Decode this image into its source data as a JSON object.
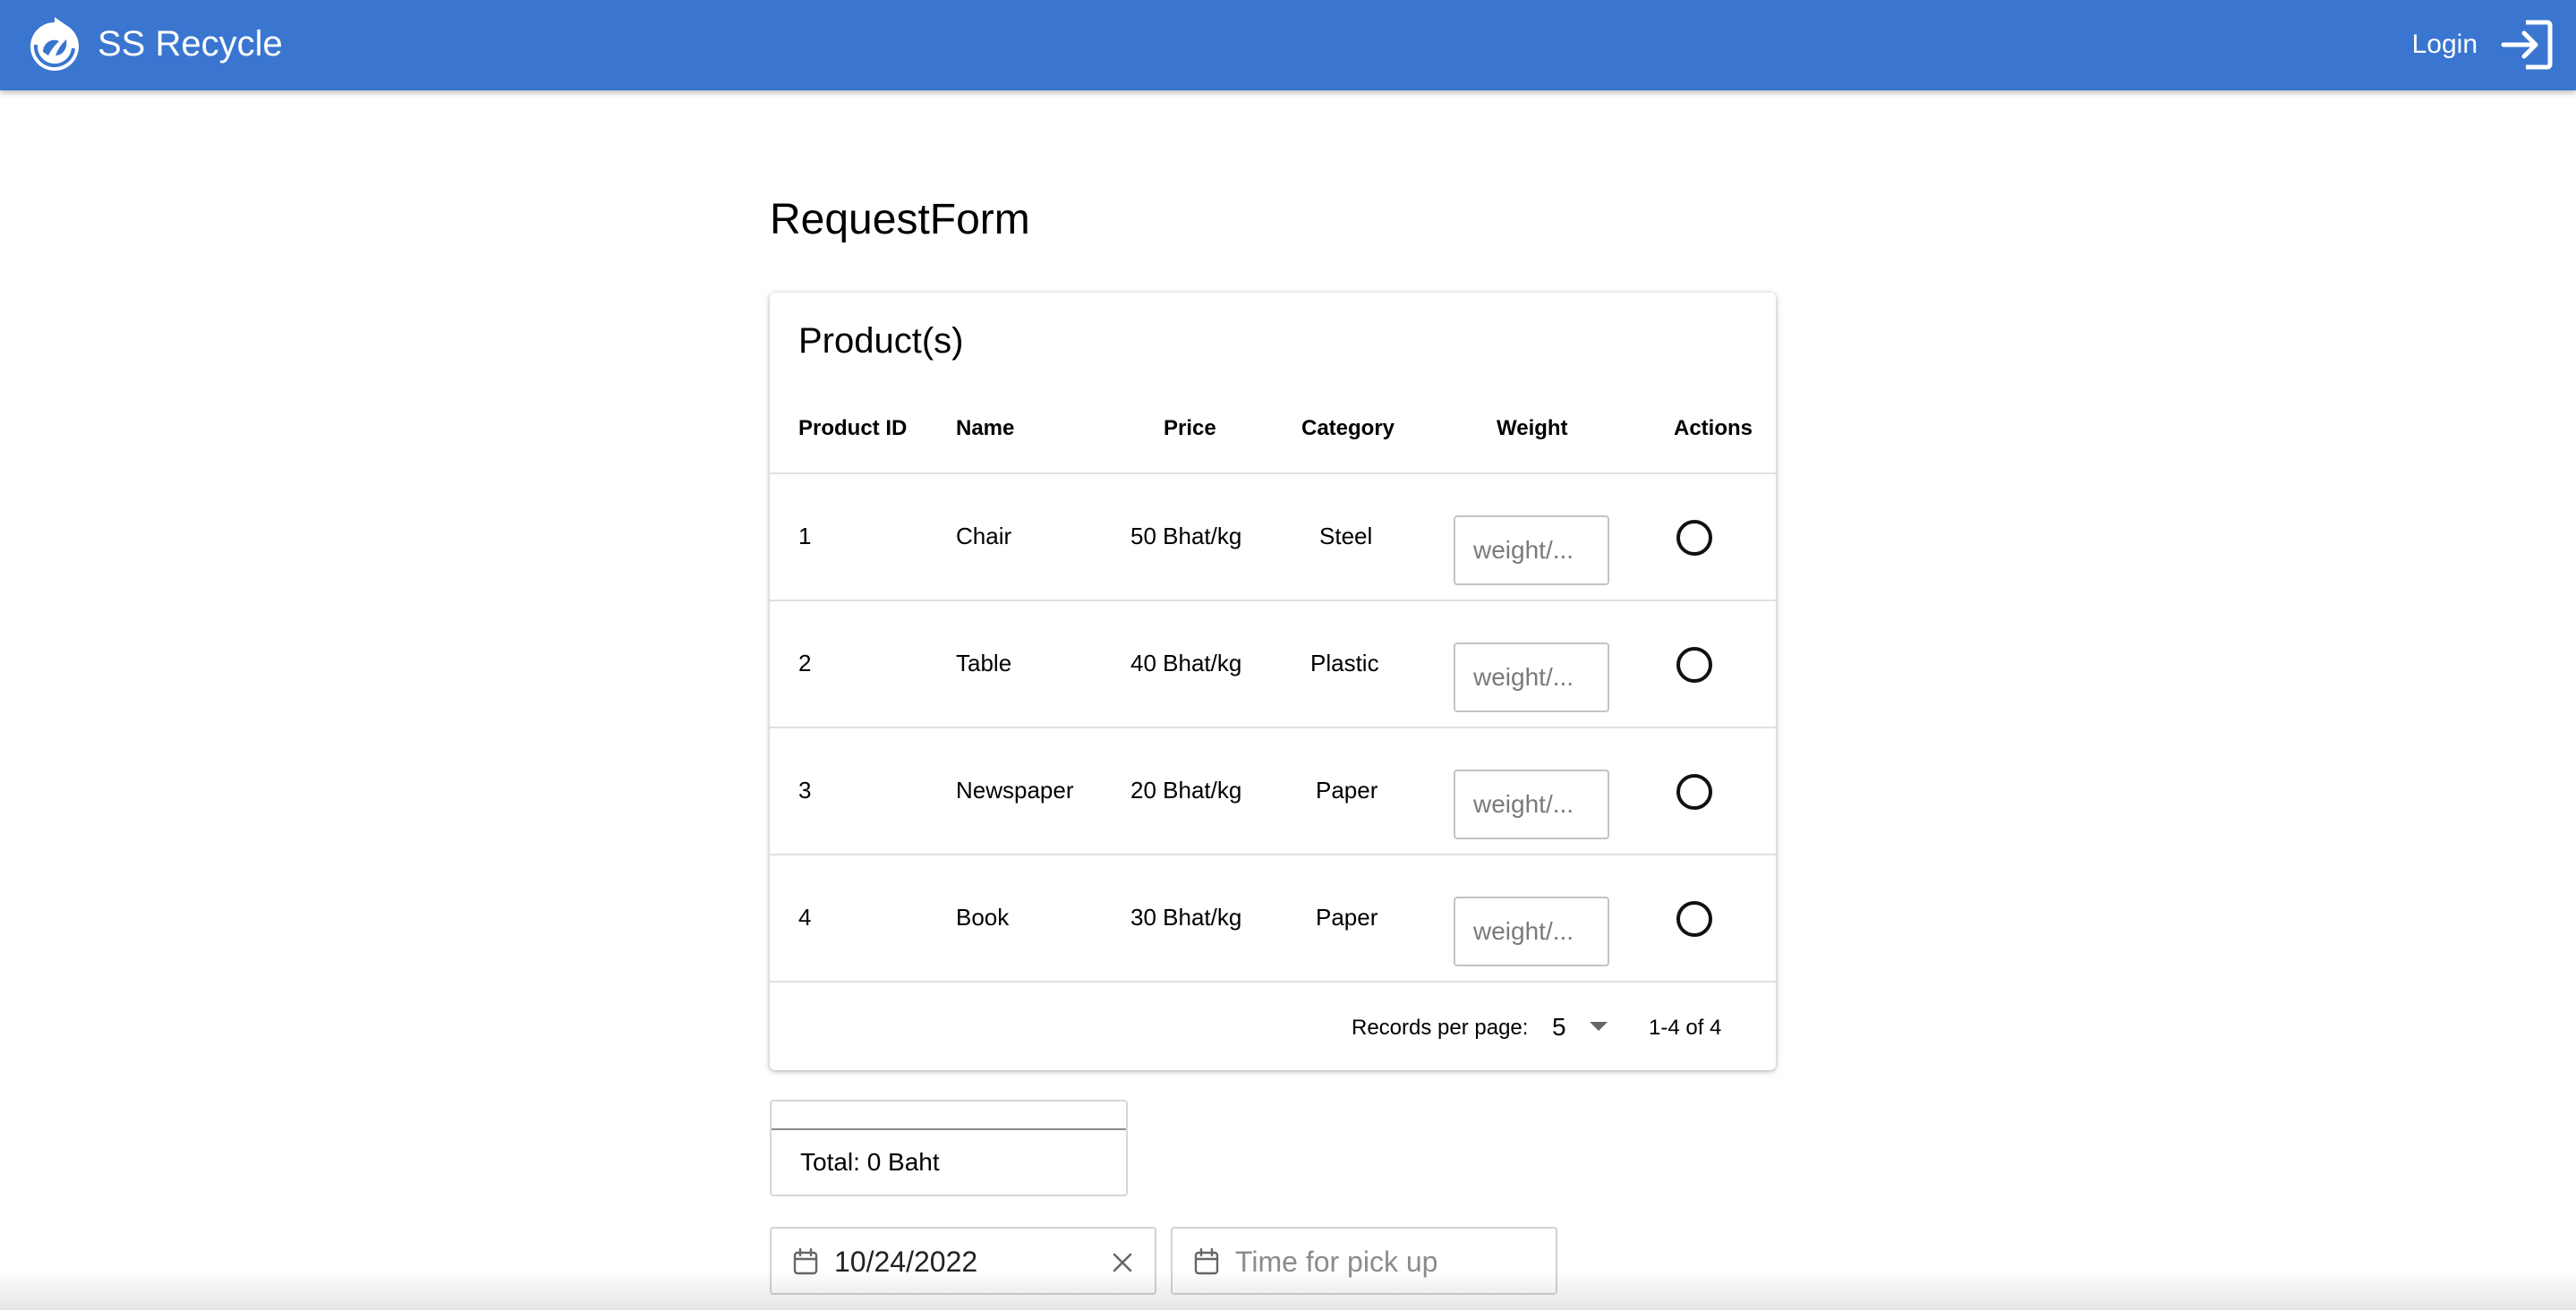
{
  "app": {
    "brand": "SS Recycle",
    "login_label": "Login",
    "brand_color": "#3a76d0"
  },
  "page": {
    "title": "RequestForm"
  },
  "products": {
    "title": "Product(s)",
    "headers": {
      "id": "Product ID",
      "name": "Name",
      "price": "Price",
      "category": "Category",
      "weight": "Weight",
      "actions": "Actions"
    },
    "rows": [
      {
        "id": "1",
        "name": "Chair",
        "price": "50 Bhat/kg",
        "category": "Steel",
        "weight_placeholder": "weight/...",
        "weight_value": "",
        "selected": false
      },
      {
        "id": "2",
        "name": "Table",
        "price": "40 Bhat/kg",
        "category": "Plastic",
        "weight_placeholder": "weight/...",
        "weight_value": "",
        "selected": false
      },
      {
        "id": "3",
        "name": "Newspaper",
        "price": "20 Bhat/kg",
        "category": "Paper",
        "weight_placeholder": "weight/...",
        "weight_value": "",
        "selected": false
      },
      {
        "id": "4",
        "name": "Book",
        "price": "30 Bhat/kg",
        "category": "Paper",
        "weight_placeholder": "weight/...",
        "weight_value": "",
        "selected": false
      }
    ],
    "pagination": {
      "records_label": "Records per page:",
      "records_value": "5",
      "range": "1-4 of 4"
    }
  },
  "total": {
    "text": "Total: 0 Baht"
  },
  "pickup": {
    "date_value": "10/24/2022",
    "time_placeholder": "Time for pick up"
  },
  "icons": {
    "logo": "recycle-logo-icon",
    "login": "login-icon",
    "calendar": "calendar-icon",
    "clear": "close-icon",
    "dropdown": "caret-down-icon"
  }
}
